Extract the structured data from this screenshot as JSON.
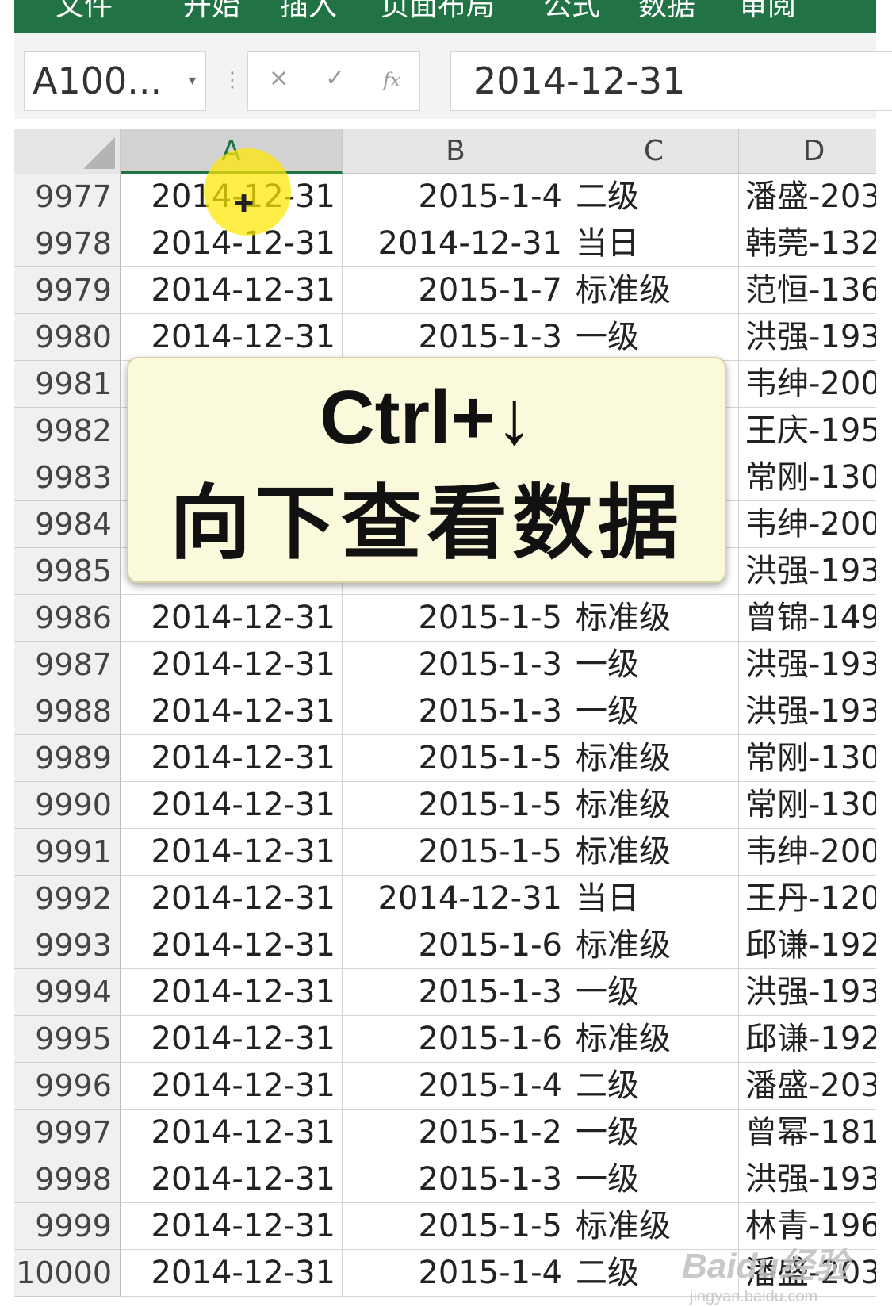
{
  "ribbon": {
    "tabs": [
      "文件",
      "开始",
      "插入",
      "页面布局",
      "公式",
      "数据",
      "审阅"
    ]
  },
  "name_box": {
    "value": "A100...",
    "dropdown_icon": "chevron-down-icon"
  },
  "formula_bar": {
    "cancel_icon": "×",
    "enter_icon": "✓",
    "function_icon": "fx",
    "content": "2014-12-31"
  },
  "columns": [
    "A",
    "B",
    "C",
    "D"
  ],
  "selected_column": "A",
  "rows": [
    {
      "num": "9977",
      "a": "2014-12-31",
      "b": "2015-1-4",
      "c": "二级",
      "d": "潘盛-203"
    },
    {
      "num": "9978",
      "a": "2014-12-31",
      "b": "2014-12-31",
      "c": "当日",
      "d": "韩莞-132"
    },
    {
      "num": "9979",
      "a": "2014-12-31",
      "b": "2015-1-7",
      "c": "标准级",
      "d": "范恒-136"
    },
    {
      "num": "9980",
      "a": "2014-12-31",
      "b": "2015-1-3",
      "c": "一级",
      "d": "洪强-193"
    },
    {
      "num": "9981",
      "a": "",
      "b": "",
      "c": "",
      "d": "韦绅-200"
    },
    {
      "num": "9982",
      "a": "",
      "b": "",
      "c": "",
      "d": "王庆-195"
    },
    {
      "num": "9983",
      "a": "",
      "b": "",
      "c": "",
      "d": "常刚-130"
    },
    {
      "num": "9984",
      "a": "",
      "b": "",
      "c": "",
      "d": "韦绅-200"
    },
    {
      "num": "9985",
      "a": "",
      "b": "",
      "c": "",
      "d": "洪强-193"
    },
    {
      "num": "9986",
      "a": "2014-12-31",
      "b": "2015-1-5",
      "c": "标准级",
      "d": "曾锦-149"
    },
    {
      "num": "9987",
      "a": "2014-12-31",
      "b": "2015-1-3",
      "c": "一级",
      "d": "洪强-193"
    },
    {
      "num": "9988",
      "a": "2014-12-31",
      "b": "2015-1-3",
      "c": "一级",
      "d": "洪强-193"
    },
    {
      "num": "9989",
      "a": "2014-12-31",
      "b": "2015-1-5",
      "c": "标准级",
      "d": "常刚-130"
    },
    {
      "num": "9990",
      "a": "2014-12-31",
      "b": "2015-1-5",
      "c": "标准级",
      "d": "常刚-130"
    },
    {
      "num": "9991",
      "a": "2014-12-31",
      "b": "2015-1-5",
      "c": "标准级",
      "d": "韦绅-200"
    },
    {
      "num": "9992",
      "a": "2014-12-31",
      "b": "2014-12-31",
      "c": "当日",
      "d": "王丹-120"
    },
    {
      "num": "9993",
      "a": "2014-12-31",
      "b": "2015-1-6",
      "c": "标准级",
      "d": "邱谦-192"
    },
    {
      "num": "9994",
      "a": "2014-12-31",
      "b": "2015-1-3",
      "c": "一级",
      "d": "洪强-193"
    },
    {
      "num": "9995",
      "a": "2014-12-31",
      "b": "2015-1-6",
      "c": "标准级",
      "d": "邱谦-192"
    },
    {
      "num": "9996",
      "a": "2014-12-31",
      "b": "2015-1-4",
      "c": "二级",
      "d": "潘盛-203"
    },
    {
      "num": "9997",
      "a": "2014-12-31",
      "b": "2015-1-2",
      "c": "一级",
      "d": "曾幂-181"
    },
    {
      "num": "9998",
      "a": "2014-12-31",
      "b": "2015-1-3",
      "c": "一级",
      "d": "洪强-193"
    },
    {
      "num": "9999",
      "a": "2014-12-31",
      "b": "2015-1-5",
      "c": "标准级",
      "d": "林青-196"
    },
    {
      "num": "10000",
      "a": "2014-12-31",
      "b": "2015-1-4",
      "c": "二级",
      "d": "潘盛-203"
    }
  ],
  "overlay": {
    "line1": "Ctrl+↓",
    "line2": "向下查看数据"
  },
  "watermark": {
    "brand": "Baidu经验",
    "url": "jingyan.baidu.com"
  },
  "colors": {
    "ribbon": "#217346",
    "highlight": "#ffe800",
    "overlay_bg": "#fbf9dc"
  }
}
